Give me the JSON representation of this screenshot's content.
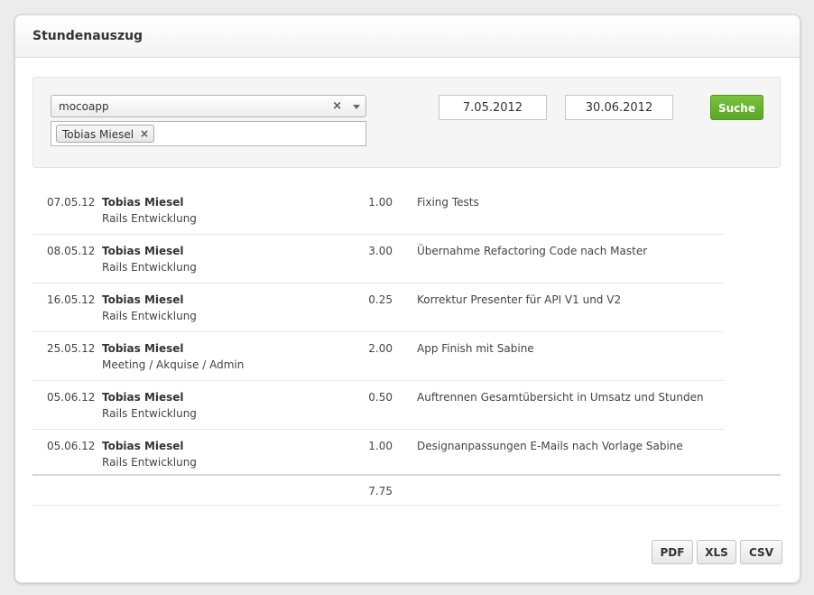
{
  "header": {
    "title": "Stundenauszug"
  },
  "filter": {
    "project_select": {
      "value": "mocoapp",
      "clear": "×"
    },
    "users": [
      {
        "label": "Tobias Miesel",
        "remove": "×"
      }
    ],
    "date_from": "7.05.2012",
    "date_to": "30.06.2012",
    "search_label": "Suche"
  },
  "entries": [
    {
      "date": "07.05.12",
      "user": "Tobias Miesel",
      "task": "Rails Entwicklung",
      "hours": "1.00",
      "description": "Fixing Tests"
    },
    {
      "date": "08.05.12",
      "user": "Tobias Miesel",
      "task": "Rails Entwicklung",
      "hours": "3.00",
      "description": "Übernahme Refactoring Code nach Master"
    },
    {
      "date": "16.05.12",
      "user": "Tobias Miesel",
      "task": "Rails Entwicklung",
      "hours": "0.25",
      "description": "Korrektur Presenter für API V1 und V2"
    },
    {
      "date": "25.05.12",
      "user": "Tobias Miesel",
      "task": "Meeting / Akquise / Admin",
      "hours": "2.00",
      "description": "App Finish mit Sabine"
    },
    {
      "date": "05.06.12",
      "user": "Tobias Miesel",
      "task": "Rails Entwicklung",
      "hours": "0.50",
      "description": "Auftrennen Gesamtübersicht in Umsatz und Stunden"
    },
    {
      "date": "05.06.12",
      "user": "Tobias Miesel",
      "task": "Rails Entwicklung",
      "hours": "1.00",
      "description": "Designanpassungen E-Mails nach Vorlage Sabine"
    }
  ],
  "total_hours": "7.75",
  "export": {
    "pdf": "PDF",
    "xls": "XLS",
    "csv": "CSV"
  },
  "colors": {
    "accent_green": "#6bb431",
    "background": "#ececec",
    "panel": "#ffffff"
  }
}
